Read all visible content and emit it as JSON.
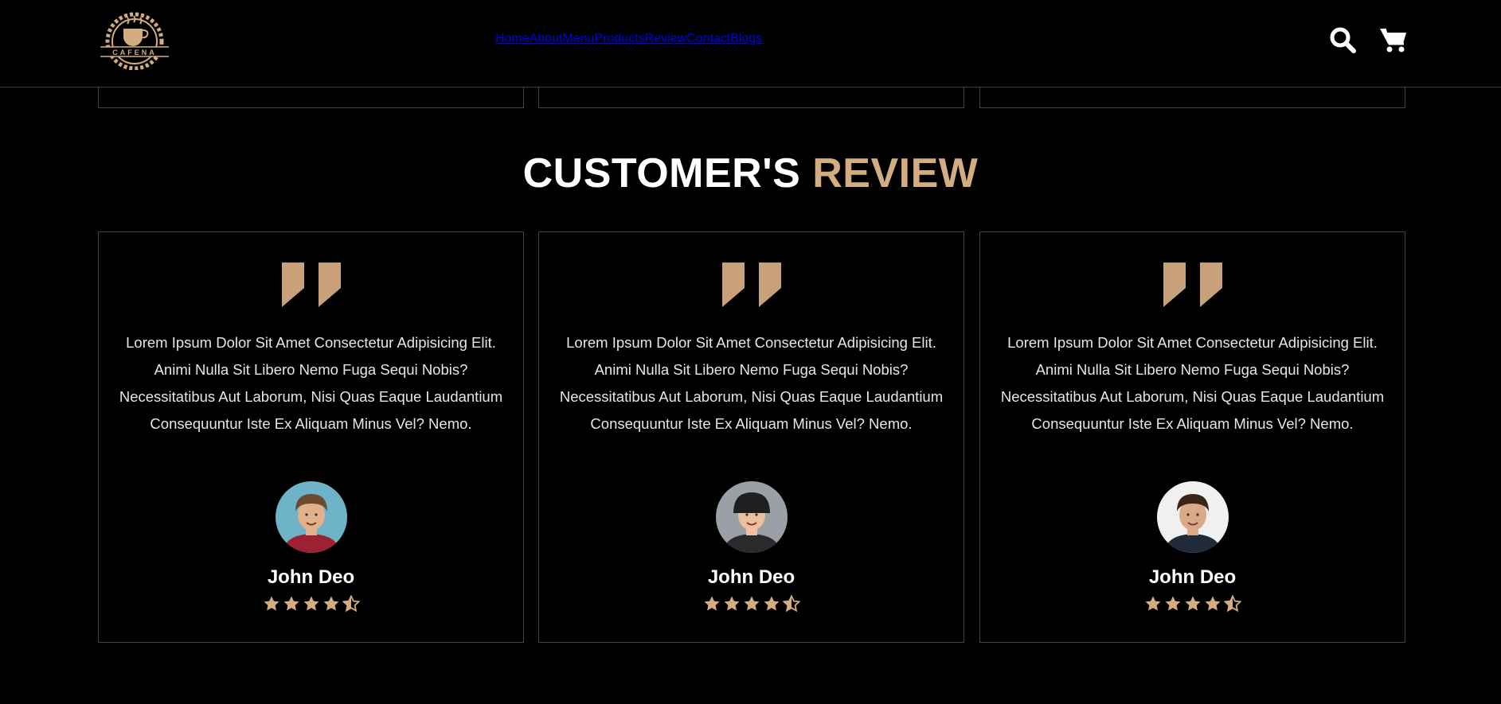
{
  "brand": {
    "logo_text": "CAFENA",
    "accent_color": "#d3ad7f"
  },
  "nav": {
    "items": [
      "Home",
      "About",
      "Menu",
      "Products",
      "Review",
      "Contact",
      "Blogs"
    ]
  },
  "header_icons": [
    "search-icon",
    "cart-icon"
  ],
  "section": {
    "title_main": "CUSTOMER'S",
    "title_accent": "REVIEW"
  },
  "reviews": [
    {
      "text": "Lorem Ipsum Dolor Sit Amet Consectetur Adipisicing Elit. Animi Nulla Sit Libero Nemo Fuga Sequi Nobis? Necessitatibus Aut Laborum, Nisi Quas Eaque Laudantium Consequuntur Iste Ex Aliquam Minus Vel? Nemo.",
      "name": "John Deo",
      "rating": 4.5
    },
    {
      "text": "Lorem Ipsum Dolor Sit Amet Consectetur Adipisicing Elit. Animi Nulla Sit Libero Nemo Fuga Sequi Nobis? Necessitatibus Aut Laborum, Nisi Quas Eaque Laudantium Consequuntur Iste Ex Aliquam Minus Vel? Nemo.",
      "name": "John Deo",
      "rating": 4.5
    },
    {
      "text": "Lorem Ipsum Dolor Sit Amet Consectetur Adipisicing Elit. Animi Nulla Sit Libero Nemo Fuga Sequi Nobis? Necessitatibus Aut Laborum, Nisi Quas Eaque Laudantium Consequuntur Iste Ex Aliquam Minus Vel? Nemo.",
      "name": "John Deo",
      "rating": 4.5
    }
  ]
}
